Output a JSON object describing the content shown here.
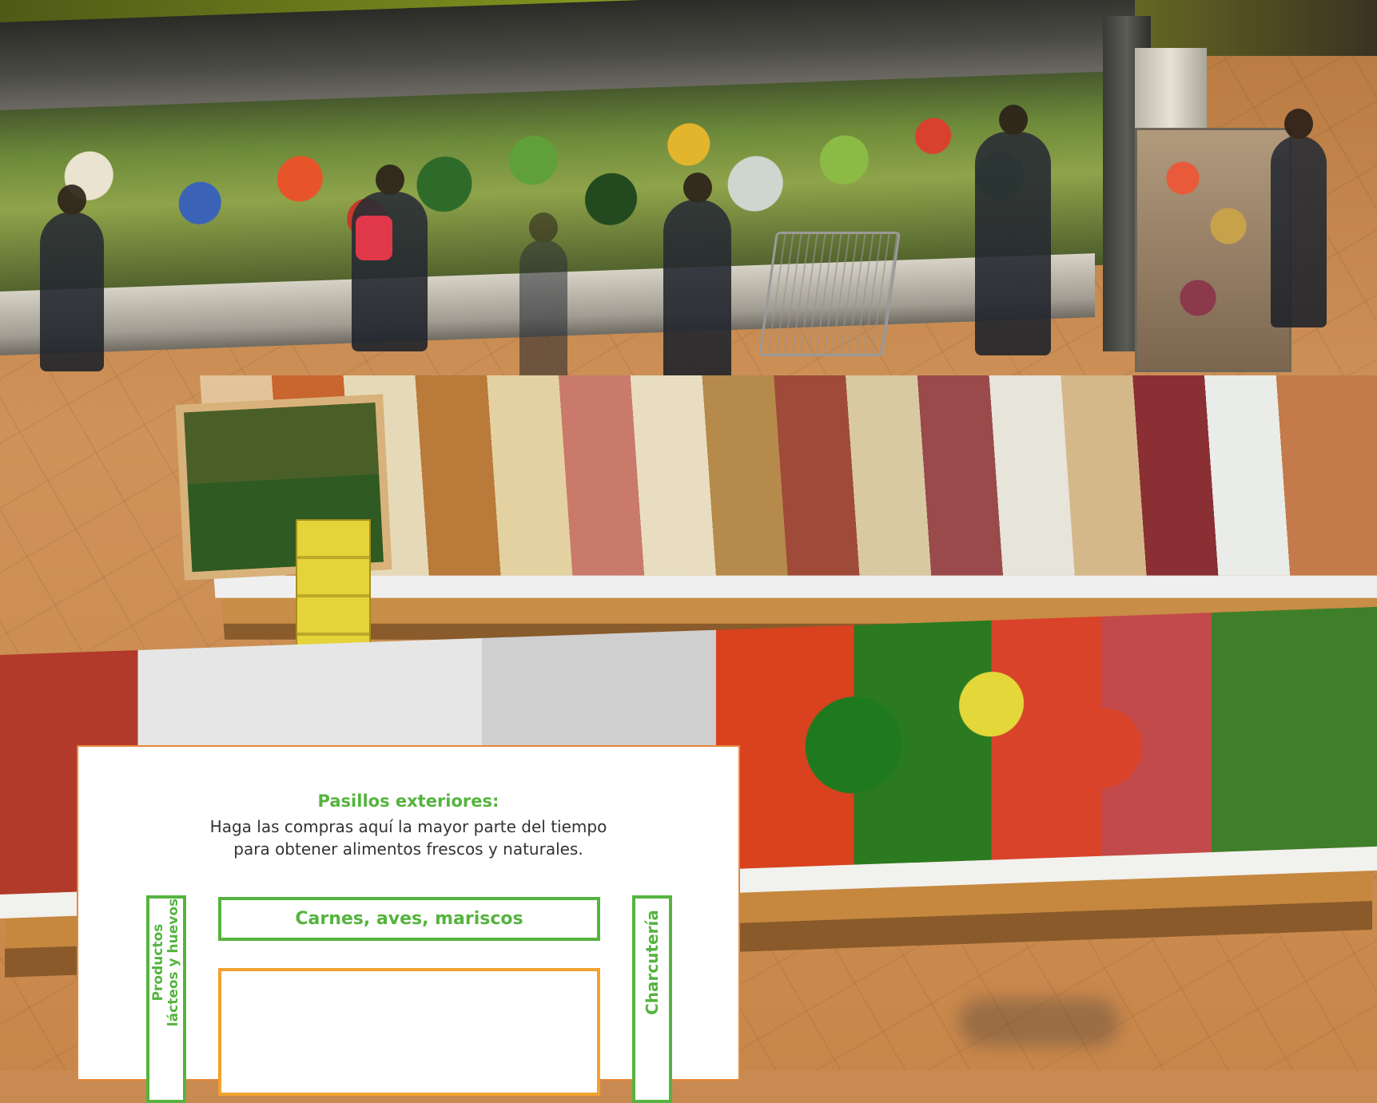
{
  "panel": {
    "heading": "Pasillos exteriores:",
    "text_line_1": "Haga las compras aquí la mayor parte del tiempo",
    "text_line_2": "para obtener alimentos frescos y naturales.",
    "aisles": {
      "top": "Carnes, aves, mariscos",
      "left_line_1": "Productos",
      "left_line_2": "lácteos y huevos",
      "right": "Charcutería",
      "center": ""
    },
    "colors": {
      "green": "#56b33f",
      "orange": "#f2a12e",
      "panel_border": "#e8873a"
    }
  },
  "scene": {
    "description_icon": "supermarket-photo"
  }
}
